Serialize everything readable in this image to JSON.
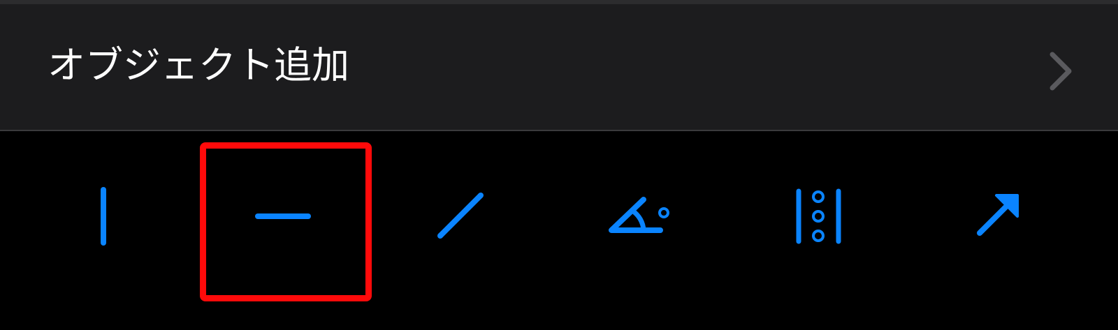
{
  "menu": {
    "label": "オブジェクト追加",
    "chevron_icon": "chevron-right-icon"
  },
  "tools": [
    {
      "name": "vertical-line-tool",
      "icon": "vertical-line-icon",
      "selected": false
    },
    {
      "name": "horizontal-line-tool",
      "icon": "horizontal-line-icon",
      "selected": true
    },
    {
      "name": "diagonal-line-tool",
      "icon": "diagonal-line-icon",
      "selected": false
    },
    {
      "name": "angle-tool",
      "icon": "angle-icon",
      "selected": false
    },
    {
      "name": "ruler-dots-tool",
      "icon": "ruler-dots-icon",
      "selected": false
    },
    {
      "name": "arrow-tool",
      "icon": "arrow-icon",
      "selected": false
    }
  ],
  "colors": {
    "accent": "#0a84ff",
    "selection": "#ff0a0a",
    "menu_background": "#1c1c1e",
    "toolbar_background": "#000000",
    "label": "#ffffff",
    "chevron": "#5a5a5e"
  }
}
